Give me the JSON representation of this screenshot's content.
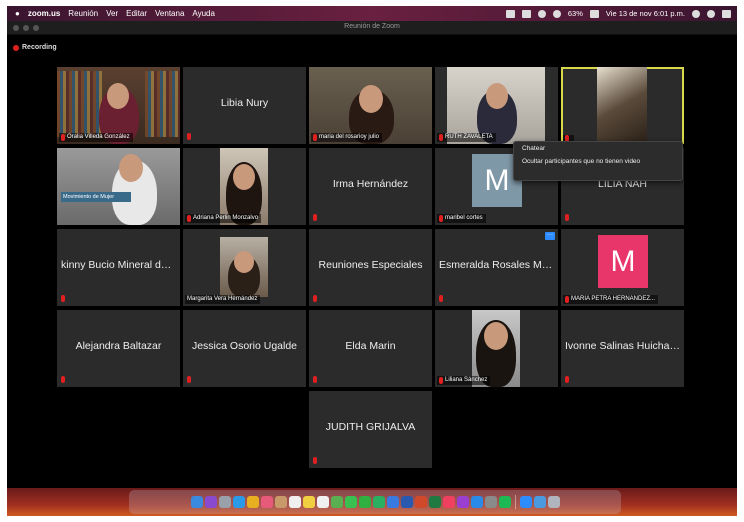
{
  "menubar": {
    "app_name": "zoom.us",
    "menus": [
      "Reunión",
      "Ver",
      "Editar",
      "Ventana",
      "Ayuda"
    ],
    "battery": "63%",
    "datetime": "Vie 13 de nov  6:01 p.m."
  },
  "window": {
    "title": "Reunión de Zoom"
  },
  "recording": {
    "label": "Recording"
  },
  "tiles": [
    {
      "name": "Oralia Villeda González",
      "type": "video"
    },
    {
      "name": "Libia Nury",
      "type": "name"
    },
    {
      "name": "maria del rosarioy julio",
      "type": "video"
    },
    {
      "name": "RUTH ZAVALETA",
      "type": "video"
    },
    {
      "name": "",
      "type": "video",
      "active": true
    },
    {
      "name": "Adriana Perlin Monzalvo",
      "type": "video"
    },
    {
      "name": "Irma Hernández",
      "type": "name"
    },
    {
      "name": "maribel cortes",
      "type": "avatar",
      "initial": "M",
      "avatar_color": "#7f98a8"
    },
    {
      "name": "LILIA  NAH",
      "type": "name"
    },
    {
      "name": "kinny Bucio Mineral de l...",
      "type": "name"
    },
    {
      "name": "Margarita Vera Hernández",
      "type": "video"
    },
    {
      "name": "Reuniones Especiales",
      "type": "name"
    },
    {
      "name": "Esmeralda Rosales Min...",
      "type": "name"
    },
    {
      "name": "MARIA PETRA HERNANDEZ...",
      "type": "avatar",
      "initial": "M",
      "avatar_color": "#e8356a"
    },
    {
      "name": "Alejandra Baltazar",
      "type": "name"
    },
    {
      "name": "Jessica Osorio Ugalde",
      "type": "name"
    },
    {
      "name": "Elda Marin",
      "type": "name"
    },
    {
      "name": "Liliana Sánchez",
      "type": "video"
    },
    {
      "name": "Ivonne Salinas Huichap...",
      "type": "name"
    },
    {
      "name": "JUDITH GRIJALVA",
      "type": "name"
    }
  ],
  "video_overlays": {
    "banner_text": "Movimiento de Mujer"
  },
  "context_menu": {
    "items": [
      "Chatear",
      "Ocultar participantes que no tienen video"
    ]
  },
  "colors": {
    "accent_active": "#d8d84a",
    "mic_muted": "#e02020",
    "zoom_blue": "#2d8cff"
  }
}
